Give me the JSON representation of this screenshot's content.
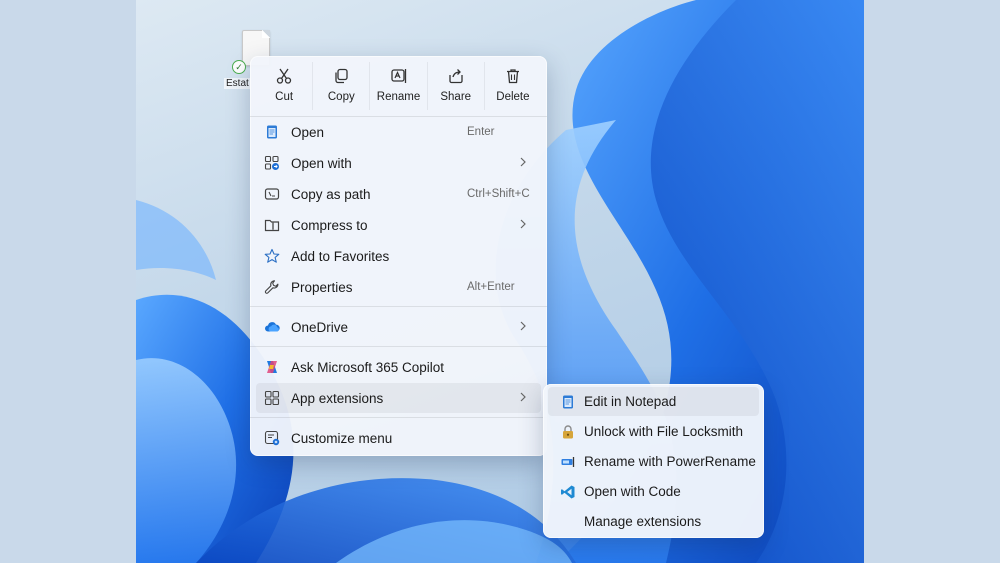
{
  "desktop": {
    "file_label": "Estat"
  },
  "quick_actions": [
    {
      "label": "Cut",
      "icon": "scissors-icon"
    },
    {
      "label": "Copy",
      "icon": "copy-icon"
    },
    {
      "label": "Rename",
      "icon": "rename-icon"
    },
    {
      "label": "Share",
      "icon": "share-icon"
    },
    {
      "label": "Delete",
      "icon": "trash-icon"
    }
  ],
  "menu": {
    "open": {
      "label": "Open",
      "shortcut": "Enter",
      "icon": "notepad-icon"
    },
    "open_with": {
      "label": "Open with",
      "icon": "open-with-icon"
    },
    "copy_as_path": {
      "label": "Copy as path",
      "shortcut": "Ctrl+Shift+C",
      "icon": "copy-path-icon"
    },
    "compress_to": {
      "label": "Compress to",
      "icon": "zip-folder-icon"
    },
    "add_to_favorites": {
      "label": "Add to Favorites",
      "icon": "star-icon"
    },
    "properties": {
      "label": "Properties",
      "shortcut": "Alt+Enter",
      "icon": "wrench-icon"
    },
    "onedrive": {
      "label": "OneDrive",
      "icon": "cloud-icon"
    },
    "ask_copilot": {
      "label": "Ask Microsoft 365 Copilot",
      "icon": "copilot-icon"
    },
    "app_extensions": {
      "label": "App extensions",
      "icon": "grid-icon"
    },
    "customize_menu": {
      "label": "Customize menu",
      "icon": "customize-icon"
    }
  },
  "submenu": {
    "items": [
      {
        "label": "Edit in Notepad",
        "icon": "notepad-icon"
      },
      {
        "label": "Unlock with File Locksmith",
        "icon": "lock-icon"
      },
      {
        "label": "Rename with PowerRename",
        "icon": "power-rename-icon"
      },
      {
        "label": "Open with Code",
        "icon": "vscode-icon"
      },
      {
        "label": "Manage extensions",
        "icon": ""
      }
    ]
  },
  "colors": {
    "accent": "#0f6cbd",
    "wallpaper_blue": "#1e6fe0",
    "menu_bg": "#f1f5fb"
  }
}
